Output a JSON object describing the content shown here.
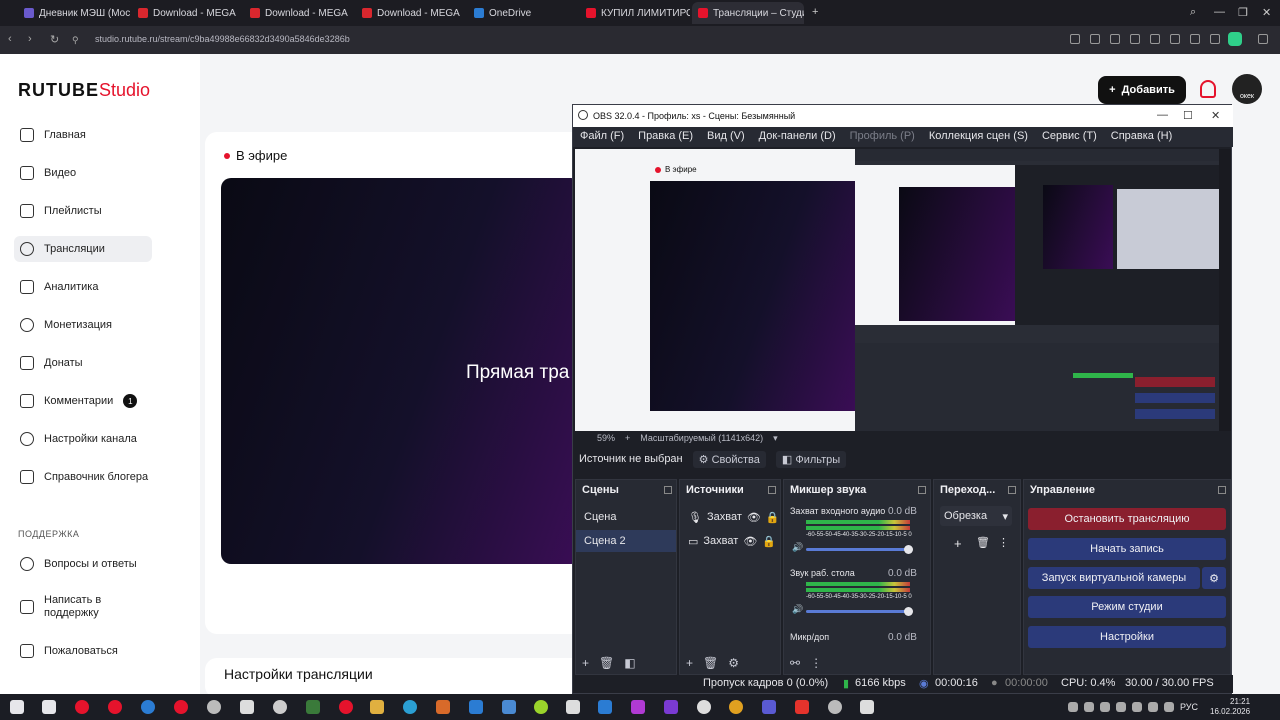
{
  "browser": {
    "tabs": [
      {
        "label": "Дневник МЭШ (Московс",
        "color": "#6a5acd"
      },
      {
        "label": "Download - MEGA",
        "color": "#d9272e"
      },
      {
        "label": "Download - MEGA",
        "color": "#d9272e"
      },
      {
        "label": "Download - MEGA",
        "color": "#d9272e"
      },
      {
        "label": "OneDrive",
        "color": "#2b7cd3"
      },
      {
        "label": "КУПИЛ ЛИМИТИРОВАН",
        "color": "#e5132c"
      },
      {
        "label": "Трансляции – Студия RU",
        "color": "#e5132c"
      }
    ],
    "new_tab": "+",
    "url": "studio.rutube.ru/stream/c9ba49988e66832d3490a5846de3286b"
  },
  "studio": {
    "logo_main": "RUTUBE",
    "logo_sub": "Studio",
    "nav": [
      {
        "label": "Главная",
        "icon": "home-icon"
      },
      {
        "label": "Видео",
        "icon": "video-icon"
      },
      {
        "label": "Плейлисты",
        "icon": "playlist-icon"
      },
      {
        "label": "Трансляции",
        "icon": "broadcast-icon",
        "active": true
      },
      {
        "label": "Аналитика",
        "icon": "analytics-icon"
      },
      {
        "label": "Монетизация",
        "icon": "monetization-icon"
      },
      {
        "label": "Донаты",
        "icon": "donate-icon"
      },
      {
        "label": "Комментарии",
        "icon": "comments-icon",
        "badge": "1"
      },
      {
        "label": "Настройки канала",
        "icon": "settings-icon"
      },
      {
        "label": "Справочник блогера",
        "icon": "handbook-icon"
      }
    ],
    "support_label": "ПОДДЕРЖКА",
    "support": [
      {
        "label": "Вопросы и ответы"
      },
      {
        "label": "Написать в поддержку"
      },
      {
        "label": "Пожаловаться"
      }
    ],
    "add_button": "Добавить",
    "avatar_text": "окек",
    "onair": "В эфире",
    "preview_text": "Прямая тра",
    "settings_title": "Настройки трансляции"
  },
  "obs": {
    "title": "OBS 32.0.4 - Профиль: xs - Сцены: Безымянный",
    "menu": [
      "Файл (F)",
      "Правка (E)",
      "Вид (V)",
      "Док-панели (D)",
      "Профиль (P)",
      "Коллекция сцен (S)",
      "Сервис (T)",
      "Справка (H)"
    ],
    "canvas_onair": "В эфире",
    "canvas_text": "Прямая тр",
    "zoom": "59%",
    "scale_mode": "Масштабируемый (1141x642)",
    "no_source": "Источник не выбран",
    "properties": "Свойства",
    "filters": "Фильтры",
    "scenes_title": "Сцены",
    "scenes": [
      "Сцена",
      "Сцена 2"
    ],
    "sources_title": "Источники",
    "sources": [
      {
        "label": "Захват",
        "icon": "mic-icon"
      },
      {
        "label": "Захват",
        "icon": "monitor-icon"
      }
    ],
    "mixer_title": "Микшер звука",
    "mixer": [
      {
        "label": "Захват входного аудио",
        "db": "0.0 dB",
        "scale": "-60-55-50-45-40-35-30-25-20-15-10-5 0"
      },
      {
        "label": "Звук раб. стола",
        "db": "0.0 dB",
        "scale": "-60-55-50-45-40-35-30-25-20-15-10-5 0"
      },
      {
        "label": "Микр/доп",
        "db": "0.0 dB"
      }
    ],
    "transitions_title": "Переход...",
    "transition_value": "Обрезка",
    "controls_title": "Управление",
    "controls": [
      "Остановить трансляцию",
      "Начать запись",
      "Запуск виртуальной камеры",
      "Режим студии",
      "Настройки"
    ],
    "status": {
      "dropped": "Пропуск кадров 0 (0.0%)",
      "bitrate": "6166 kbps",
      "stream_time": "00:00:16",
      "rec_time": "00:00:00",
      "cpu": "CPU: 0.4%",
      "fps": "30.00 / 30.00 FPS"
    }
  },
  "taskbar": {
    "lang": "РУС",
    "time": "21:21",
    "date": "16.02.2026"
  }
}
